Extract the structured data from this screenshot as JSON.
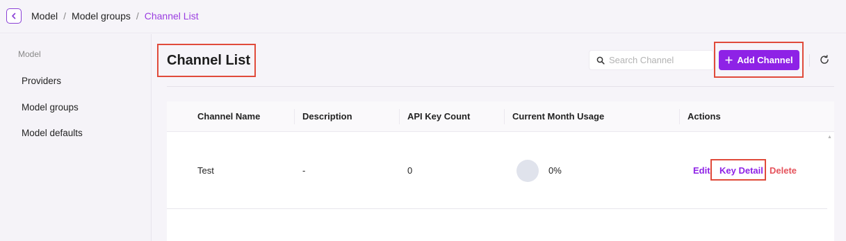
{
  "breadcrumb": {
    "items": [
      "Model",
      "Model groups",
      "Channel List"
    ],
    "separator": "/"
  },
  "sidebar": {
    "section": "Model",
    "items": [
      "Providers",
      "Model groups",
      "Model defaults"
    ]
  },
  "page": {
    "title": "Channel List"
  },
  "toolbar": {
    "search_placeholder": "Search Channel",
    "add_label": "Add Channel",
    "add_icon": "+"
  },
  "table": {
    "columns": [
      "Channel Name",
      "Description",
      "API Key Count",
      "Current Month Usage",
      "Actions"
    ],
    "rows": [
      {
        "name": "Test",
        "description": "-",
        "api_key_count": "0",
        "usage": "0%",
        "actions": [
          "Edit",
          "Key Detail",
          "Delete"
        ]
      }
    ]
  },
  "colors": {
    "accent": "#8e22e6",
    "active_crumb": "#9a3de0",
    "danger": "#e5525b",
    "highlight_box": "#e04a3a"
  },
  "icons": {
    "back": "chevron-left-icon",
    "search": "search-icon",
    "add": "plus-icon",
    "refresh": "refresh-icon"
  }
}
